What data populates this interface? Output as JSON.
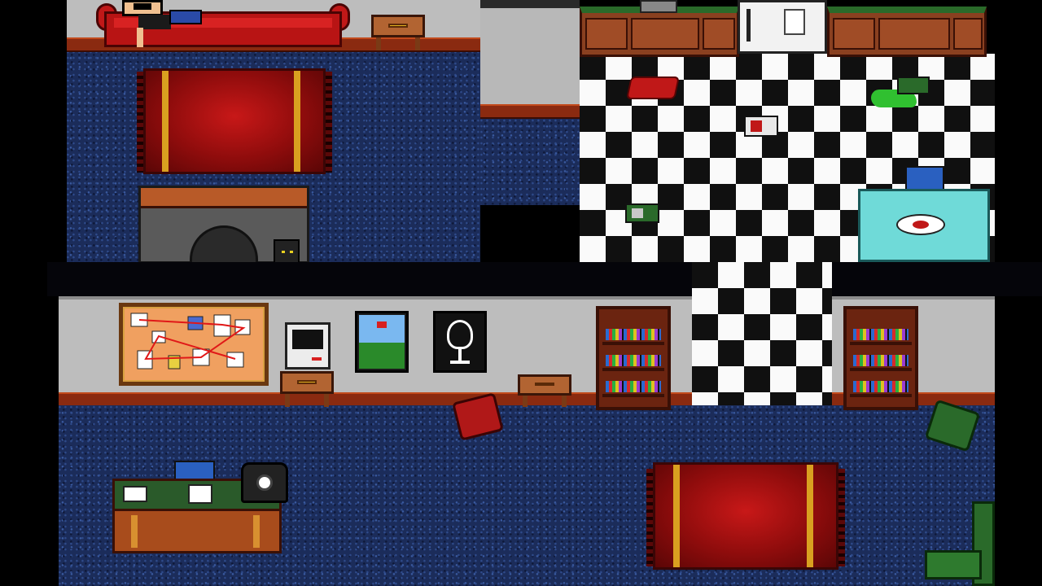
{
  "scene": {
    "type": "top-down pixel-art apartment interior",
    "rooms": [
      "living-room",
      "kitchen",
      "hallway"
    ]
  },
  "colors": {
    "carpet": "#1b2c5a",
    "wall": "#bdbdbd",
    "trim": "#8a2a10",
    "sofa": "#c01818",
    "rug": "#a80e0e",
    "rug_stripe": "#d9a020",
    "kitchen_counter": "#8a4020",
    "kitchen_table": "#6fdad8",
    "bookcase": "#6b2410",
    "book_green": "#2a6a2a",
    "book_red": "#b01818"
  },
  "icons": [
    "sofa-icon",
    "person-icon",
    "side-table-icon",
    "rug-icon",
    "fireplace-icon",
    "cat-icon",
    "counter-icon",
    "refrigerator-icon",
    "sink-icon",
    "checker-floor-icon",
    "red-cloth-icon",
    "green-slime-icon",
    "canister-icon",
    "kitchen-table-icon",
    "plate-icon",
    "corkboard-icon",
    "computer-icon",
    "landscape-painting-icon",
    "skull-picture-icon",
    "bookcase-icon",
    "book-icon",
    "desk-icon",
    "telephone-icon",
    "armchair-icon"
  ]
}
